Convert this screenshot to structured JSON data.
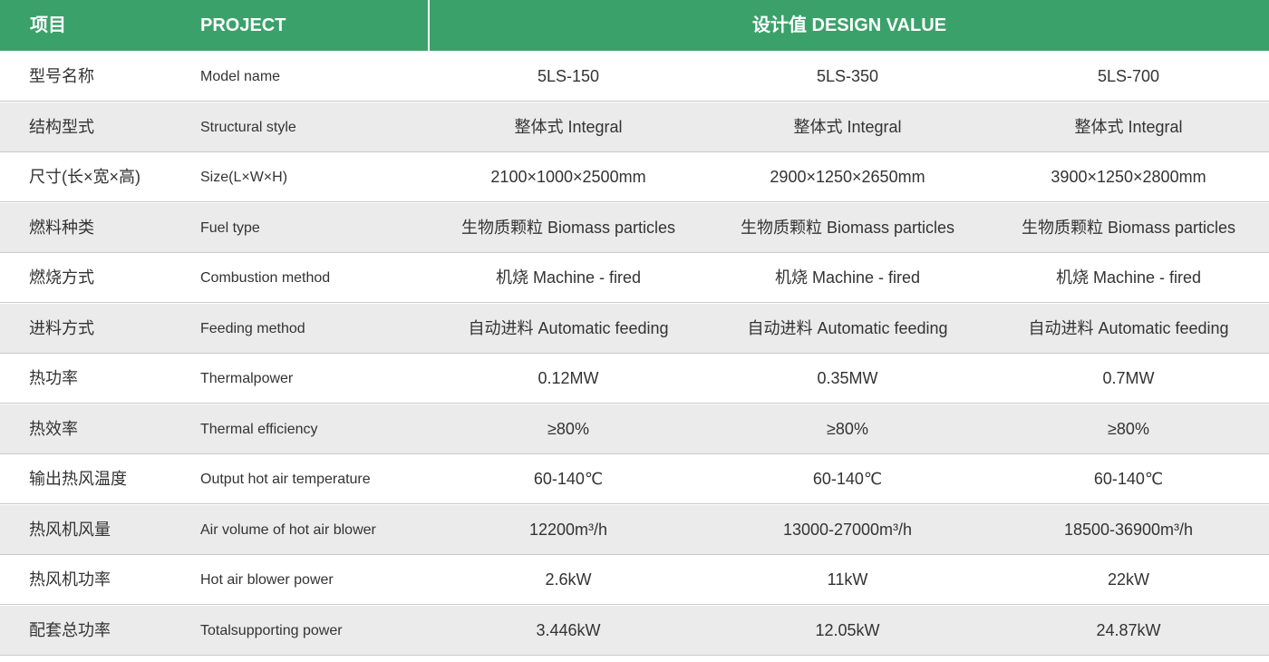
{
  "header": {
    "col1": "项目",
    "col2": "PROJECT",
    "col3": "设计值 DESIGN VALUE"
  },
  "rows": [
    {
      "cn": "型号名称",
      "en": "Model name",
      "v1": "5LS-150",
      "v2": "5LS-350",
      "v3": "5LS-700"
    },
    {
      "cn": "结构型式",
      "en": "Structural style",
      "v1": "整体式  Integral",
      "v2": "整体式  Integral",
      "v3": "整体式  Integral"
    },
    {
      "cn": "尺寸(长×宽×高)",
      "en": "Size(L×W×H)",
      "v1": "2100×1000×2500mm",
      "v2": "2900×1250×2650mm",
      "v3": "3900×1250×2800mm"
    },
    {
      "cn": "燃料种类",
      "en": "Fuel type",
      "v1": "生物质颗粒  Biomass particles",
      "v2": "生物质颗粒  Biomass particles",
      "v3": "生物质颗粒  Biomass particles"
    },
    {
      "cn": "燃烧方式",
      "en": "Combustion method",
      "v1": "机烧  Machine - fired",
      "v2": "机烧 Machine - fired",
      "v3": "机烧 Machine - fired"
    },
    {
      "cn": "进料方式",
      "en": "Feeding method",
      "v1": "自动进料  Automatic feeding",
      "v2": "自动进料  Automatic feeding",
      "v3": "自动进料  Automatic feeding"
    },
    {
      "cn": "热功率",
      "en": "Thermalpower",
      "v1": "0.12MW",
      "v2": "0.35MW",
      "v3": "0.7MW"
    },
    {
      "cn": "热效率",
      "en": "Thermal efficiency",
      "v1": "≥80%",
      "v2": "≥80%",
      "v3": "≥80%"
    },
    {
      "cn": "输出热风温度",
      "en": "Output hot air temperature",
      "v1": "60-140℃",
      "v2": "60-140℃",
      "v3": "60-140℃"
    },
    {
      "cn": "热风机风量",
      "en": "Air volume of hot air blower",
      "v1": "12200m³/h",
      "v2": "13000-27000m³/h",
      "v3": "18500-36900m³/h"
    },
    {
      "cn": "热风机功率",
      "en": "Hot air blower power",
      "v1": "2.6kW",
      "v2": "11kW",
      "v3": "22kW"
    },
    {
      "cn": "配套总功率",
      "en": "Totalsupporting power",
      "v1": "3.446kW",
      "v2": "12.05kW",
      "v3": "24.87kW"
    }
  ],
  "colors": {
    "header_bg": "#3aa16a",
    "alt_row_bg": "#ebebeb",
    "text": "#333333"
  }
}
